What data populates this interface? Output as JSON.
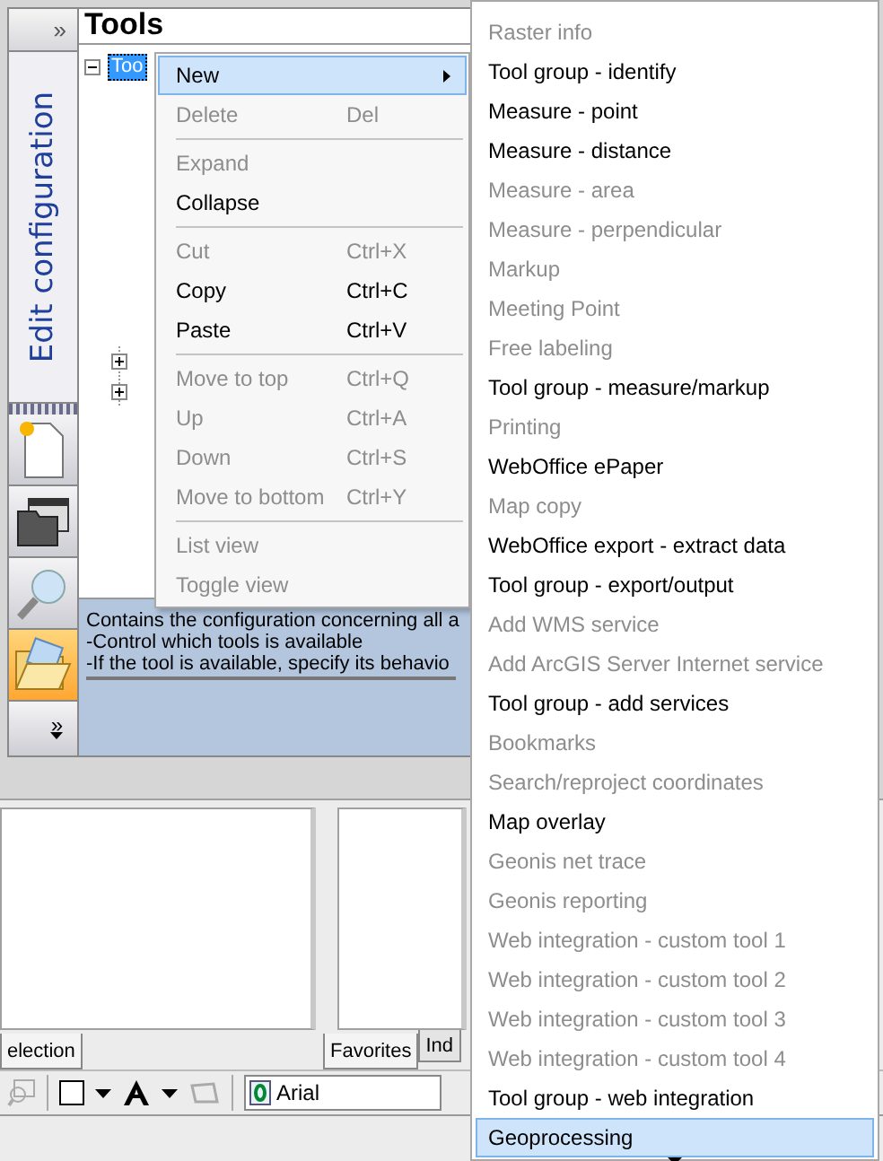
{
  "sidebar": {
    "expand_glyph": "»",
    "title": "Edit configuration",
    "buttons": [
      {
        "kind": "new-document",
        "selected": false
      },
      {
        "kind": "open-window",
        "selected": false
      },
      {
        "kind": "search",
        "selected": false
      },
      {
        "kind": "open-folder",
        "selected": true
      }
    ],
    "more_glyph": "»"
  },
  "panel": {
    "title": "Tools",
    "tree": {
      "label": "Too",
      "selected": true,
      "expanded": true,
      "children": [
        {
          "expanded": false
        },
        {
          "expanded": false
        }
      ]
    },
    "description": [
      "Contains the configuration concerning all a",
      "-Control which tools is available",
      "-If the tool is available, specify its behavio"
    ]
  },
  "context_menu": {
    "items": [
      {
        "kind": "item",
        "label": "New",
        "selected": true,
        "disabled": false,
        "submenu": true
      },
      {
        "kind": "item",
        "label": "Delete",
        "shortcut": "Del",
        "selected": false,
        "disabled": true
      },
      {
        "kind": "separator"
      },
      {
        "kind": "item",
        "label": "Expand",
        "selected": false,
        "disabled": true
      },
      {
        "kind": "item",
        "label": "Collapse",
        "selected": false,
        "disabled": false
      },
      {
        "kind": "separator"
      },
      {
        "kind": "item",
        "label": "Cut",
        "shortcut": "Ctrl+X",
        "selected": false,
        "disabled": true
      },
      {
        "kind": "item",
        "label": "Copy",
        "shortcut": "Ctrl+C",
        "selected": false,
        "disabled": false
      },
      {
        "kind": "item",
        "label": "Paste",
        "shortcut": "Ctrl+V",
        "selected": false,
        "disabled": false
      },
      {
        "kind": "separator"
      },
      {
        "kind": "item",
        "label": "Move to top",
        "shortcut": "Ctrl+Q",
        "selected": false,
        "disabled": true
      },
      {
        "kind": "item",
        "label": "Up",
        "shortcut": "Ctrl+A",
        "selected": false,
        "disabled": true
      },
      {
        "kind": "item",
        "label": "Down",
        "shortcut": "Ctrl+S",
        "selected": false,
        "disabled": true
      },
      {
        "kind": "item",
        "label": "Move to bottom",
        "shortcut": "Ctrl+Y",
        "selected": false,
        "disabled": true
      },
      {
        "kind": "separator"
      },
      {
        "kind": "item",
        "label": "List view",
        "selected": false,
        "disabled": true
      },
      {
        "kind": "item",
        "label": "Toggle view",
        "selected": false,
        "disabled": true
      }
    ]
  },
  "submenu": {
    "items": [
      {
        "label": "Raster info",
        "disabled": true,
        "selected": false
      },
      {
        "label": "Tool group - identify",
        "disabled": false,
        "selected": false
      },
      {
        "label": "Measure - point",
        "disabled": false,
        "selected": false
      },
      {
        "label": "Measure - distance",
        "disabled": false,
        "selected": false
      },
      {
        "label": "Measure - area",
        "disabled": true,
        "selected": false
      },
      {
        "label": "Measure - perpendicular",
        "disabled": true,
        "selected": false
      },
      {
        "label": "Markup",
        "disabled": true,
        "selected": false
      },
      {
        "label": "Meeting Point",
        "disabled": true,
        "selected": false
      },
      {
        "label": "Free labeling",
        "disabled": true,
        "selected": false
      },
      {
        "label": "Tool group - measure/markup",
        "disabled": false,
        "selected": false
      },
      {
        "label": "Printing",
        "disabled": true,
        "selected": false
      },
      {
        "label": "WebOffice ePaper",
        "disabled": false,
        "selected": false
      },
      {
        "label": "Map copy",
        "disabled": true,
        "selected": false
      },
      {
        "label": "WebOffice export - extract data",
        "disabled": false,
        "selected": false
      },
      {
        "label": "Tool group - export/output",
        "disabled": false,
        "selected": false
      },
      {
        "label": "Add WMS service",
        "disabled": true,
        "selected": false
      },
      {
        "label": "Add ArcGIS Server Internet service",
        "disabled": true,
        "selected": false
      },
      {
        "label": "Tool group - add services",
        "disabled": false,
        "selected": false
      },
      {
        "label": "Bookmarks",
        "disabled": true,
        "selected": false
      },
      {
        "label": "Search/reproject coordinates",
        "disabled": true,
        "selected": false
      },
      {
        "label": "Map overlay",
        "disabled": false,
        "selected": false
      },
      {
        "label": "Geonis net trace",
        "disabled": true,
        "selected": false
      },
      {
        "label": "Geonis reporting",
        "disabled": true,
        "selected": false
      },
      {
        "label": "Web integration - custom tool 1",
        "disabled": true,
        "selected": false
      },
      {
        "label": "Web integration - custom tool 2",
        "disabled": true,
        "selected": false
      },
      {
        "label": "Web integration - custom tool 3",
        "disabled": true,
        "selected": false
      },
      {
        "label": "Web integration - custom tool 4",
        "disabled": true,
        "selected": false
      },
      {
        "label": "Tool group - web integration",
        "disabled": false,
        "selected": false
      },
      {
        "label": "Geoprocessing",
        "disabled": false,
        "selected": true
      }
    ]
  },
  "bottom": {
    "left_tabs": [
      {
        "label": "election",
        "selected": true
      }
    ],
    "right_tabs": [
      {
        "label": "Favorites",
        "selected": true
      },
      {
        "label": "Ind",
        "selected": false
      }
    ],
    "toolbar": {
      "font": "Arial"
    }
  }
}
